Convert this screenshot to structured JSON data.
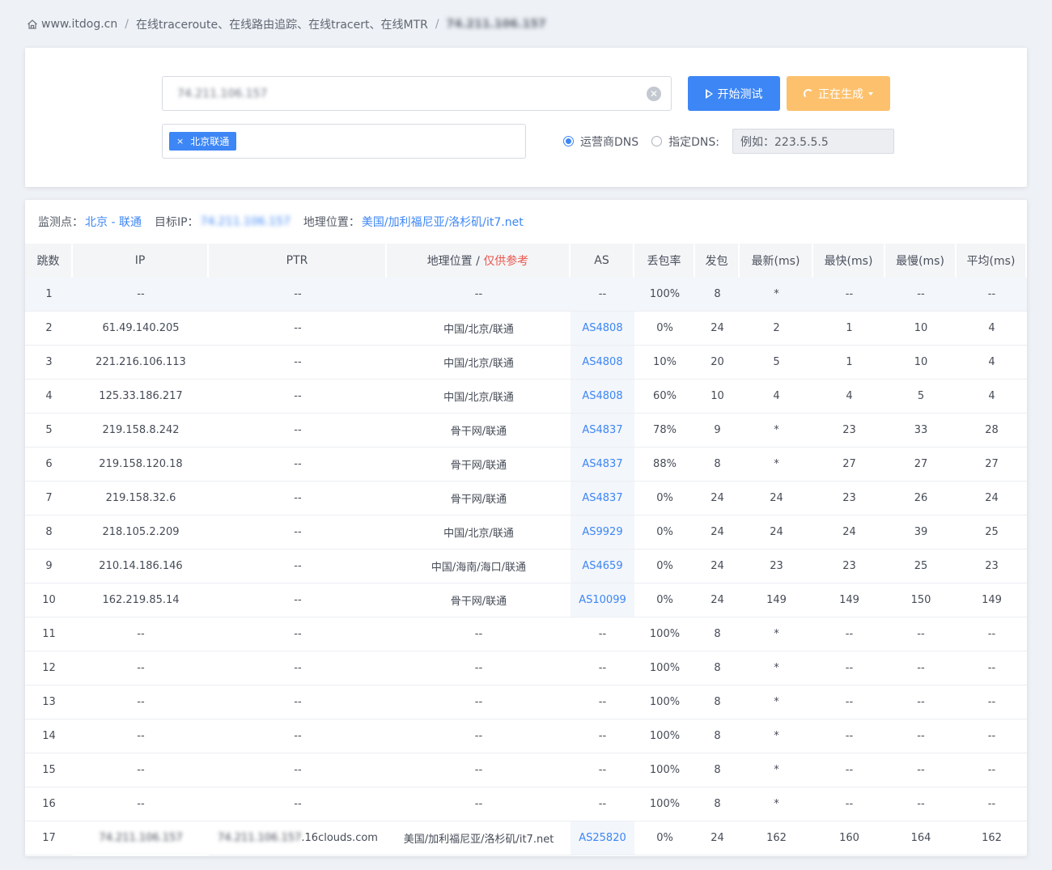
{
  "breadcrumb": {
    "site": "www.itdog.cn",
    "page": "在线traceroute、在线路由追踪、在线tracert、在线MTR",
    "current": "74.211.106.157"
  },
  "search": {
    "target_value": "74.211.106.157",
    "start_label": "开始测试",
    "generating_label": "正在生成"
  },
  "nodes": {
    "selected_tag": "北京联通",
    "tag_close": "×"
  },
  "dns": {
    "isp_label": "运营商DNS",
    "custom_label": "指定DNS:",
    "placeholder": "例如：223.5.5.5"
  },
  "result": {
    "node_label": "监测点：",
    "node_value": "北京 - 联通",
    "target_label": "目标IP：",
    "target_value": "74.211.106.157",
    "geo_label": "地理位置：",
    "geo_value": "美国/加利福尼亚/洛杉矶/it7.net"
  },
  "table": {
    "headers": {
      "hop": "跳数",
      "ip": "IP",
      "ptr": "PTR",
      "geo": "地理位置 / ",
      "geo_note": "仅供参考",
      "as": "AS",
      "loss": "丢包率",
      "sent": "发包",
      "last": "最新(ms)",
      "best": "最快(ms)",
      "worst": "最慢(ms)",
      "avg": "平均(ms)"
    },
    "rows": [
      {
        "hop": "1",
        "ip": "--",
        "ptr": "--",
        "geo": "--",
        "as": "--",
        "loss": "100%",
        "sent": "8",
        "last": "*",
        "best": "--",
        "worst": "--",
        "avg": "--"
      },
      {
        "hop": "2",
        "ip": "61.49.140.205",
        "ptr": "--",
        "geo": "中国/北京/联通",
        "as": "AS4808",
        "loss": "0%",
        "sent": "24",
        "last": "2",
        "best": "1",
        "worst": "10",
        "avg": "4"
      },
      {
        "hop": "3",
        "ip": "221.216.106.113",
        "ptr": "--",
        "geo": "中国/北京/联通",
        "as": "AS4808",
        "loss": "10%",
        "sent": "20",
        "last": "5",
        "best": "1",
        "worst": "10",
        "avg": "4"
      },
      {
        "hop": "4",
        "ip": "125.33.186.217",
        "ptr": "--",
        "geo": "中国/北京/联通",
        "as": "AS4808",
        "loss": "60%",
        "sent": "10",
        "last": "4",
        "best": "4",
        "worst": "5",
        "avg": "4"
      },
      {
        "hop": "5",
        "ip": "219.158.8.242",
        "ptr": "--",
        "geo": "骨干网/联通",
        "as": "AS4837",
        "loss": "78%",
        "sent": "9",
        "last": "*",
        "best": "23",
        "worst": "33",
        "avg": "28"
      },
      {
        "hop": "6",
        "ip": "219.158.120.18",
        "ptr": "--",
        "geo": "骨干网/联通",
        "as": "AS4837",
        "loss": "88%",
        "sent": "8",
        "last": "*",
        "best": "27",
        "worst": "27",
        "avg": "27"
      },
      {
        "hop": "7",
        "ip": "219.158.32.6",
        "ptr": "--",
        "geo": "骨干网/联通",
        "as": "AS4837",
        "loss": "0%",
        "sent": "24",
        "last": "24",
        "best": "23",
        "worst": "26",
        "avg": "24"
      },
      {
        "hop": "8",
        "ip": "218.105.2.209",
        "ptr": "--",
        "geo": "中国/北京/联通",
        "as": "AS9929",
        "loss": "0%",
        "sent": "24",
        "last": "24",
        "best": "24",
        "worst": "39",
        "avg": "25"
      },
      {
        "hop": "9",
        "ip": "210.14.186.146",
        "ptr": "--",
        "geo": "中国/海南/海口/联通",
        "as": "AS4659",
        "loss": "0%",
        "sent": "24",
        "last": "23",
        "best": "23",
        "worst": "25",
        "avg": "23"
      },
      {
        "hop": "10",
        "ip": "162.219.85.14",
        "ptr": "--",
        "geo": "骨干网/联通",
        "as": "AS10099",
        "loss": "0%",
        "sent": "24",
        "last": "149",
        "best": "149",
        "worst": "150",
        "avg": "149"
      },
      {
        "hop": "11",
        "ip": "--",
        "ptr": "--",
        "geo": "--",
        "as": "--",
        "loss": "100%",
        "sent": "8",
        "last": "*",
        "best": "--",
        "worst": "--",
        "avg": "--"
      },
      {
        "hop": "12",
        "ip": "--",
        "ptr": "--",
        "geo": "--",
        "as": "--",
        "loss": "100%",
        "sent": "8",
        "last": "*",
        "best": "--",
        "worst": "--",
        "avg": "--"
      },
      {
        "hop": "13",
        "ip": "--",
        "ptr": "--",
        "geo": "--",
        "as": "--",
        "loss": "100%",
        "sent": "8",
        "last": "*",
        "best": "--",
        "worst": "--",
        "avg": "--"
      },
      {
        "hop": "14",
        "ip": "--",
        "ptr": "--",
        "geo": "--",
        "as": "--",
        "loss": "100%",
        "sent": "8",
        "last": "*",
        "best": "--",
        "worst": "--",
        "avg": "--"
      },
      {
        "hop": "15",
        "ip": "--",
        "ptr": "--",
        "geo": "--",
        "as": "--",
        "loss": "100%",
        "sent": "8",
        "last": "*",
        "best": "--",
        "worst": "--",
        "avg": "--"
      },
      {
        "hop": "16",
        "ip": "--",
        "ptr": "--",
        "geo": "--",
        "as": "--",
        "loss": "100%",
        "sent": "8",
        "last": "*",
        "best": "--",
        "worst": "--",
        "avg": "--"
      },
      {
        "hop": "17",
        "ip": "74.211.106.157",
        "ptr": "74.211.106.157.16clouds.com",
        "geo": "美国/加利福尼亚/洛杉矶/it7.net",
        "as": "AS25820",
        "loss": "0%",
        "sent": "24",
        "last": "162",
        "best": "160",
        "worst": "164",
        "avg": "162"
      }
    ]
  },
  "colors": {
    "accent": "#3d86f5",
    "warning_button": "#fdc16d",
    "note_red": "#e9574e",
    "page_bg": "#eef1f6"
  }
}
